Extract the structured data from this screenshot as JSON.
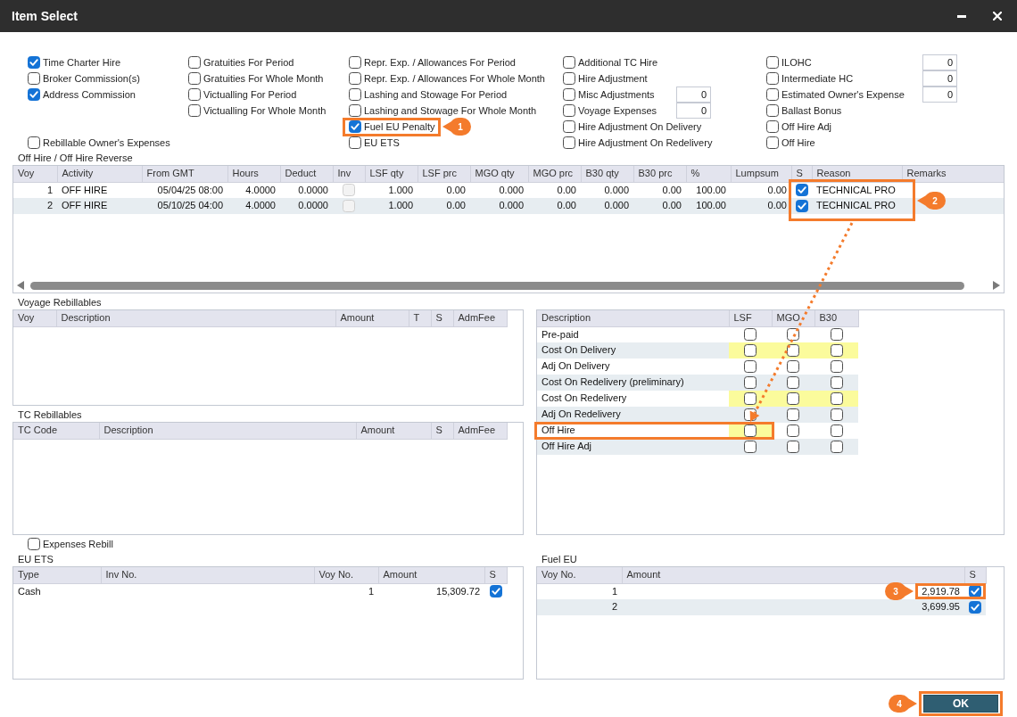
{
  "window": {
    "title": "Item Select"
  },
  "options": {
    "columns": [
      {
        "items": [
          {
            "label": "Time Charter Hire",
            "checked": true
          },
          {
            "label": "Broker Commission(s)",
            "checked": false
          },
          {
            "label": "Address Commission",
            "checked": true
          }
        ],
        "bottom_item": {
          "label": "Rebillable Owner's Expenses",
          "checked": false
        }
      },
      {
        "items": [
          {
            "label": "Gratuities For Period",
            "checked": false
          },
          {
            "label": "Gratuities For Whole Month",
            "checked": false
          },
          {
            "label": "Victualling For Period",
            "checked": false
          },
          {
            "label": "Victualling For Whole Month",
            "checked": false
          }
        ]
      },
      {
        "items": [
          {
            "label": "Repr. Exp. / Allowances For Period",
            "checked": false
          },
          {
            "label": "Repr. Exp. / Allowances For Whole Month",
            "checked": false
          },
          {
            "label": "Lashing and Stowage For Period",
            "checked": false
          },
          {
            "label": "Lashing and Stowage For Whole Month",
            "checked": false
          },
          {
            "label": "Fuel EU Penalty",
            "checked": true,
            "callout": "1"
          },
          {
            "label": "EU ETS",
            "checked": false
          }
        ]
      },
      {
        "items": [
          {
            "label": "Additional TC Hire",
            "checked": false
          },
          {
            "label": "Hire Adjustment",
            "checked": false
          },
          {
            "label": "Misc Adjustments",
            "checked": false,
            "value": "0"
          },
          {
            "label": "Voyage Expenses",
            "checked": false,
            "value": "0"
          },
          {
            "label": "Hire Adjustment On Delivery",
            "checked": false
          },
          {
            "label": "Hire Adjustment On Redelivery",
            "checked": false
          }
        ]
      },
      {
        "items": [
          {
            "label": "ILOHC",
            "checked": false,
            "value": "0"
          },
          {
            "label": "Intermediate HC",
            "checked": false,
            "value": "0"
          },
          {
            "label": "Estimated Owner's Expense",
            "checked": false,
            "value": "0"
          },
          {
            "label": "Ballast Bonus",
            "checked": false
          },
          {
            "label": "Off Hire Adj",
            "checked": false
          },
          {
            "label": "Off Hire",
            "checked": false
          }
        ]
      }
    ]
  },
  "off_hire": {
    "title": "Off Hire / Off Hire Reverse",
    "columns": [
      {
        "label": "Voy",
        "marked": false
      },
      {
        "label": "Activity",
        "marked": false
      },
      {
        "label": "From GMT",
        "marked": false
      },
      {
        "label": "Hours",
        "marked": false
      },
      {
        "label": "Deduct",
        "marked": false
      },
      {
        "label": "Inv",
        "marked": false
      },
      {
        "label": "LSF qty",
        "marked": false
      },
      {
        "label": "LSF prc",
        "marked": false
      },
      {
        "label": "MGO qty",
        "marked": false
      },
      {
        "label": "MGO prc",
        "marked": false
      },
      {
        "label": "B30 qty",
        "marked": false
      },
      {
        "label": "B30 prc",
        "marked": false
      },
      {
        "label": "%",
        "marked": false
      },
      {
        "label": "Lumpsum",
        "marked": false
      },
      {
        "label": "S",
        "marked": true
      },
      {
        "label": "Reason",
        "marked": true
      },
      {
        "label": "Remarks",
        "marked": false
      }
    ],
    "rows": [
      {
        "cells": [
          "1",
          "OFF HIRE",
          "05/04/25 08:00",
          "4.0000",
          "0.0000",
          {
            "checked": false,
            "disabled": true
          },
          "1.000",
          "0.00",
          "0.000",
          "0.00",
          "0.000",
          "0.00",
          "100.00",
          "0.00",
          {
            "checked": true,
            "disabled": false
          },
          "TECHNICAL PRO"
        ]
      },
      {
        "cells": [
          "2",
          "OFF HIRE",
          "05/10/25 04:00",
          "4.0000",
          "0.0000",
          {
            "checked": false,
            "disabled": true
          },
          "1.000",
          "0.00",
          "0.000",
          "0.00",
          "0.000",
          "0.00",
          "100.00",
          "0.00",
          {
            "checked": true,
            "disabled": false
          },
          "TECHNICAL PRO"
        ]
      }
    ],
    "callout": "2"
  },
  "voyage_rebillables": {
    "title": "Voyage Rebillables",
    "columns": [
      "Voy",
      "Description",
      "Amount",
      "T",
      "S",
      "AdmFee"
    ]
  },
  "tc_rebillables": {
    "title": "TC Rebillables",
    "columns": [
      "TC Code",
      "Description",
      "Amount",
      "S",
      "AdmFee"
    ]
  },
  "fuel_costs": {
    "columns": [
      "Description",
      "LSF",
      "MGO",
      "B30"
    ],
    "rows": [
      {
        "description": "Pre-paid",
        "marked": false,
        "cells": [
          {
            "checked": false,
            "highlighted": false
          },
          {
            "checked": false,
            "highlighted": false
          },
          {
            "checked": false,
            "highlighted": false
          }
        ]
      },
      {
        "description": "Cost On Delivery",
        "marked": false,
        "cells": [
          {
            "checked": false,
            "highlighted": true
          },
          {
            "checked": false,
            "highlighted": true
          },
          {
            "checked": false,
            "highlighted": true
          }
        ]
      },
      {
        "description": "Adj On Delivery",
        "marked": false,
        "cells": [
          {
            "checked": false,
            "highlighted": false
          },
          {
            "checked": false,
            "highlighted": false
          },
          {
            "checked": false,
            "highlighted": false
          }
        ]
      },
      {
        "description": "Cost On Redelivery (preliminary)",
        "marked": false,
        "cells": [
          {
            "checked": false,
            "highlighted": false
          },
          {
            "checked": false,
            "highlighted": false
          },
          {
            "checked": false,
            "highlighted": false
          }
        ]
      },
      {
        "description": "Cost On Redelivery",
        "marked": false,
        "cells": [
          {
            "checked": false,
            "highlighted": true
          },
          {
            "checked": false,
            "highlighted": true
          },
          {
            "checked": false,
            "highlighted": true
          }
        ]
      },
      {
        "description": "Adj On Redelivery",
        "marked": false,
        "cells": [
          {
            "checked": false,
            "highlighted": false
          },
          {
            "checked": false,
            "highlighted": false
          },
          {
            "checked": false,
            "highlighted": false
          }
        ]
      },
      {
        "description": "Off Hire",
        "marked": true,
        "cells": [
          {
            "checked": false,
            "highlighted": true
          },
          {
            "checked": false,
            "highlighted": false
          },
          {
            "checked": false,
            "highlighted": false
          }
        ]
      },
      {
        "description": "Off Hire Adj",
        "marked": false,
        "cells": [
          {
            "checked": false,
            "highlighted": false
          },
          {
            "checked": false,
            "highlighted": false
          },
          {
            "checked": false,
            "highlighted": false
          }
        ]
      }
    ]
  },
  "expenses_rebill": {
    "label": "Expenses Rebill",
    "checked": false
  },
  "eu_ets": {
    "title": "EU ETS",
    "columns": [
      "Type",
      "Inv No.",
      "Voy No.",
      "Amount",
      "S"
    ],
    "rows": [
      {
        "type": "Cash",
        "voy_no": "1",
        "amount": "15,309.72",
        "checked": true
      }
    ]
  },
  "fuel_eu": {
    "title": "Fuel EU",
    "columns": [
      "Voy No.",
      "Amount",
      "S"
    ],
    "rows": [
      {
        "voy_no": "1",
        "amount": "2,919.78",
        "checked": true,
        "callout": "3"
      },
      {
        "voy_no": "2",
        "amount": "3,699.95",
        "checked": true
      }
    ]
  },
  "ok_button": {
    "label": "OK",
    "callout": "4"
  }
}
